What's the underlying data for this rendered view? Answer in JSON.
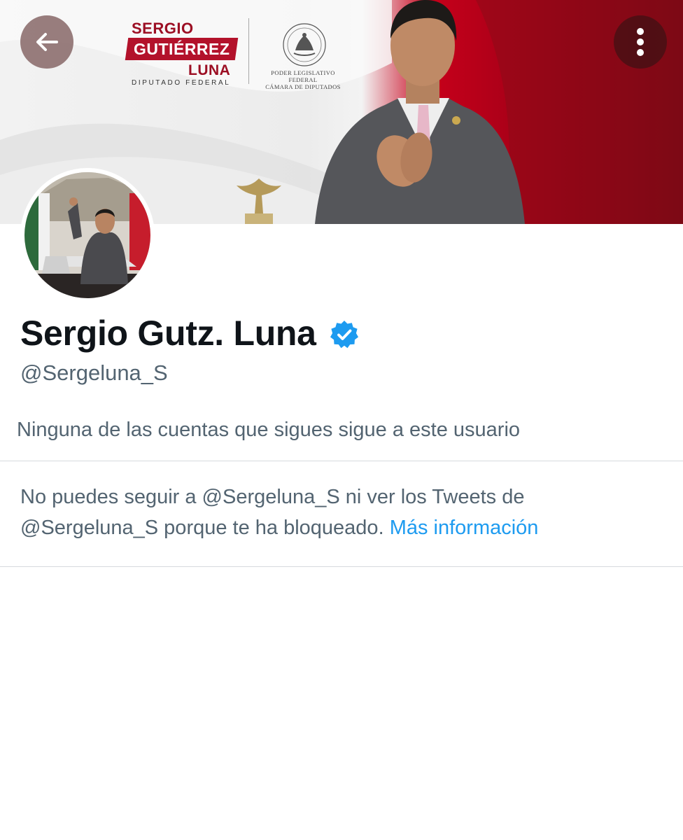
{
  "banner": {
    "logo_line1": "SERGIO",
    "logo_line2": "GUTIÉRREZ",
    "logo_line3": "LUNA",
    "logo_line4": "DIPUTADO FEDERAL",
    "seal_text_line1": "PODER LEGISLATIVO FEDERAL",
    "seal_text_line2": "CÁMARA DE DIPUTADOS"
  },
  "profile": {
    "display_name": "Sergio Gutz. Luna",
    "handle": "@Sergeluna_S",
    "followers_note": "Ninguna de las cuentas que sigues sigue a este usuario"
  },
  "blocked": {
    "message_line1": "No puedes seguir a @Sergeluna_S ni ver los Tweets de",
    "message_line2": "@Sergeluna_S porque te ha bloqueado.",
    "link_text": "Más información"
  },
  "icons": {
    "back": "arrow-left-icon",
    "more": "more-vertical-icon",
    "verified": "verified-badge-icon"
  },
  "colors": {
    "accent": "#1d9bf0",
    "verified": "#1d9bf0",
    "text_primary": "#0f1419",
    "text_secondary": "#536471",
    "divider": "#d6dade"
  }
}
